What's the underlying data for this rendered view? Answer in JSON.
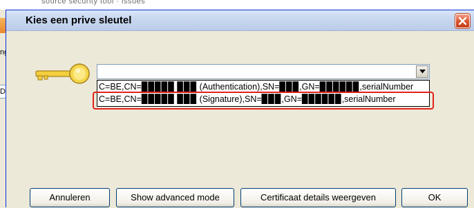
{
  "background": {
    "title_fragment": "source security tool · issues",
    "edge_labels": [
      "ng",
      "De"
    ]
  },
  "dialog": {
    "title": "Kies een prive sleutel",
    "close_icon": "close-icon",
    "key_icon": "key-icon",
    "combo": {
      "value": "",
      "arrow_icon": "chevron-down-icon"
    },
    "options": [
      "C=BE,CN=▉▉▉▉▉ ▉▉▉ (Authentication),SN=▉▉▉,GN=▉▉▉▉▉▉,serialNumber",
      "C=BE,CN=▉▉▉▉▉ ▉▉▉ (Signature),SN=▉▉▉,GN=▉▉▉▉▉▉,serialNumber"
    ],
    "buttons": {
      "cancel": "Annuleren",
      "advanced": "Show advanced mode",
      "details": "Certificaat details weergeven",
      "ok": "OK"
    }
  },
  "colors": {
    "highlight": "#e0231b",
    "titlebar": "#c9d8f0",
    "close": "#d9532c"
  }
}
